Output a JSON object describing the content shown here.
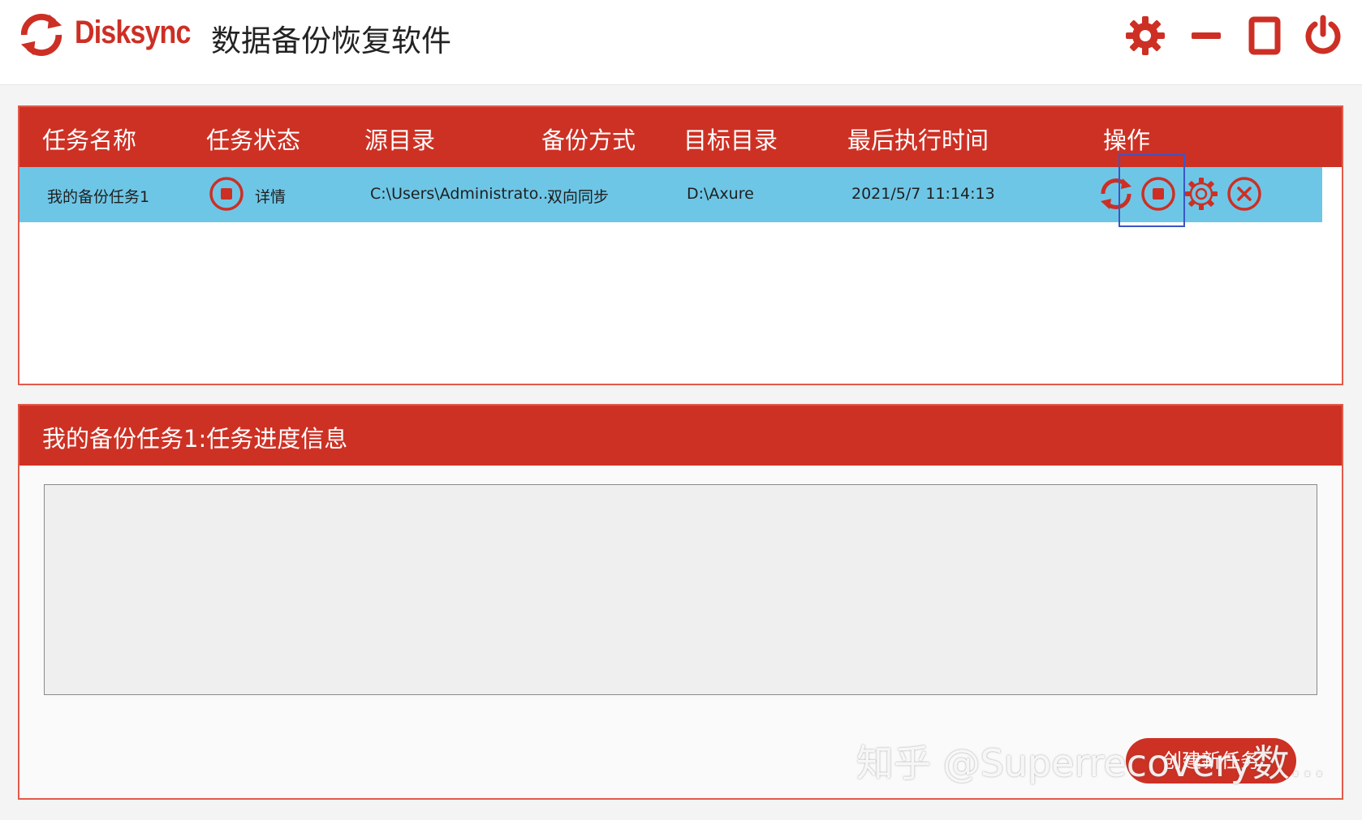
{
  "app": {
    "brand": "Disksync",
    "title": "数据备份恢复软件"
  },
  "icons": {
    "logo": "sync-arrows-icon",
    "settings": "gear-icon",
    "minimize": "minimize-icon",
    "maximize": "maximize-icon",
    "power": "power-icon",
    "status": "stop-circle-icon",
    "sync": "sync-icon",
    "stop": "stop-circle-icon",
    "task_settings": "gear-outline-icon",
    "delete": "close-circle-icon"
  },
  "colors": {
    "accent": "#cd3124",
    "row_highlight": "#6ec6e6",
    "focus": "#3b56c6"
  },
  "task_table": {
    "columns": [
      "任务名称",
      "任务状态",
      "源目录",
      "备份方式",
      "目标目录",
      "最后执行时间",
      "操作"
    ],
    "rows": [
      {
        "name": "我的备份任务1",
        "status_link": "详情",
        "source": "C:\\Users\\Administrato...",
        "mode": "双向同步",
        "target": "D:\\Axure",
        "last_run": "2021/5/7 11:14:13"
      }
    ]
  },
  "progress": {
    "title": "我的备份任务1:任务进度信息",
    "log": ""
  },
  "new_task_button": "创建新任务",
  "watermark": "知乎 @Superrecovery数..."
}
